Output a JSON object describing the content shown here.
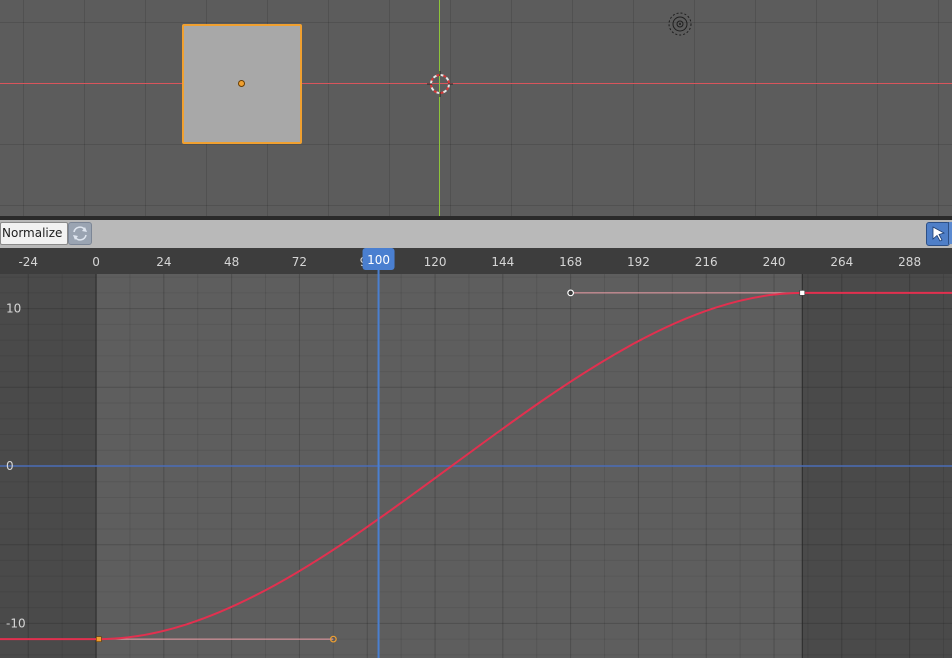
{
  "viewport": {
    "x_axis_color": "#d9555c",
    "y_axis_color": "#8ec53a",
    "selection_color": "#f0a030",
    "icons": [
      "3d-cursor-icon",
      "light-icon"
    ]
  },
  "graph_header": {
    "normalize_label": "Normalize",
    "icons": [
      "auto-normalize-icon",
      "select-arrow-icon"
    ]
  },
  "graph": {
    "current_frame": "100",
    "frame_indicator_color": "#4a7fd0",
    "curve_color": "#e2304f",
    "zero_line_color": "#4a6db8",
    "scene_start": 0,
    "scene_end": 250
  },
  "chart_data": {
    "type": "line",
    "xlim": [
      -34,
      303
    ],
    "ylim": [
      -12.2,
      12.2
    ],
    "x_ticks": [
      "-24",
      "0",
      "24",
      "48",
      "72",
      "96",
      "120",
      "144",
      "168",
      "192",
      "216",
      "240",
      "264",
      "288"
    ],
    "x_tick_values": [
      -24,
      0,
      24,
      48,
      72,
      96,
      120,
      144,
      168,
      192,
      216,
      240,
      264,
      288
    ],
    "y_ticks": [
      "10",
      "0",
      "-10"
    ],
    "y_tick_values": [
      10,
      0,
      -10
    ],
    "keyframes": [
      {
        "frame": 1,
        "value": -11,
        "handle_right": {
          "frame": 84,
          "value": -11
        }
      },
      {
        "frame": 250,
        "value": 11,
        "handle_left": {
          "frame": 168,
          "value": 11
        }
      }
    ],
    "series": [
      {
        "interpolation": "bezier",
        "color": "#e2304f"
      }
    ],
    "grid": true
  }
}
